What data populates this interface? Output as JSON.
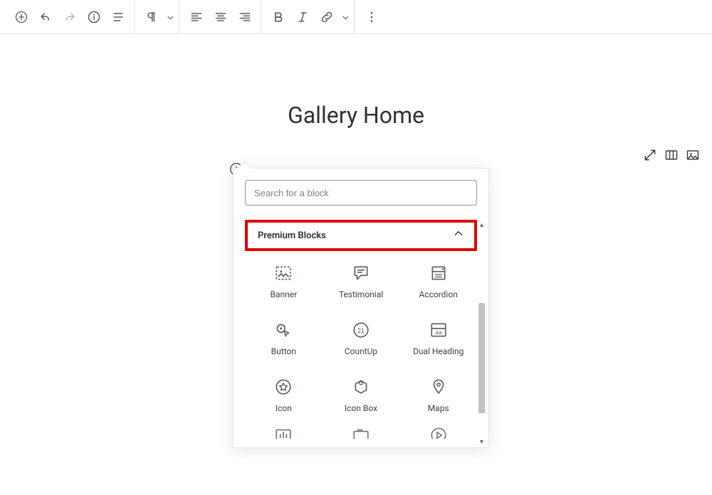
{
  "toolbar": {
    "icons": {
      "add": "add-icon",
      "undo": "undo-icon",
      "redo": "redo-icon",
      "info": "info-icon",
      "outline": "outline-icon",
      "paragraph": "paragraph-icon",
      "align_left": "align-left-icon",
      "align_center": "align-center-icon",
      "align_right": "align-right-icon",
      "bold": "bold-icon",
      "italic": "italic-icon",
      "link": "link-icon",
      "more": "more-icon"
    }
  },
  "page": {
    "title": "Gallery Home"
  },
  "right_actions": {
    "fullscreen": "fullscreen-icon",
    "columns": "columns-icon",
    "image": "image-icon"
  },
  "inserter": {
    "search_placeholder": "Search for a block",
    "category_label": "Premium Blocks",
    "blocks": [
      {
        "label": "Banner",
        "icon": "banner"
      },
      {
        "label": "Testimonial",
        "icon": "testimonial"
      },
      {
        "label": "Accordion",
        "icon": "accordion"
      },
      {
        "label": "Button",
        "icon": "button"
      },
      {
        "label": "CountUp",
        "icon": "countup"
      },
      {
        "label": "Dual Heading",
        "icon": "dualheading"
      },
      {
        "label": "Icon",
        "icon": "icon"
      },
      {
        "label": "Icon Box",
        "icon": "iconbox"
      },
      {
        "label": "Maps",
        "icon": "maps"
      }
    ],
    "blocks_next_row": [
      {
        "icon": "chart"
      },
      {
        "icon": "tabs"
      },
      {
        "icon": "video"
      }
    ]
  }
}
